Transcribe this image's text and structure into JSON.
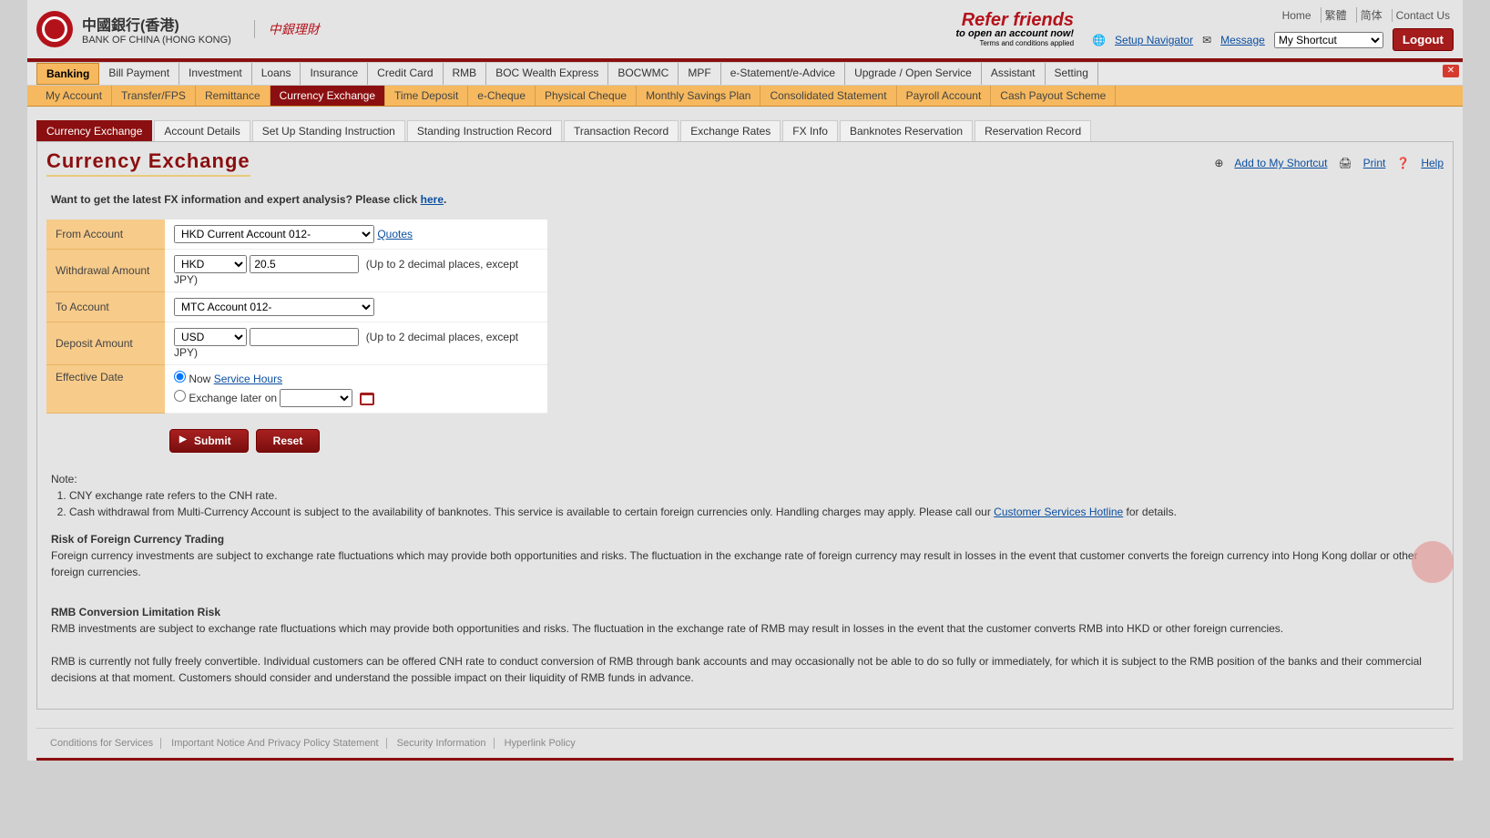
{
  "header": {
    "bank_name_cn": "中國銀行(香港)",
    "bank_name_en": "BANK OF CHINA (HONG KONG)",
    "wealth_brand": "中銀理財",
    "promo_title": "Refer friends",
    "promo_sub": "to open an account now!",
    "promo_terms": "Terms and conditions applied",
    "meta_links": [
      "Home",
      "繁體",
      "简体",
      "Contact Us"
    ],
    "setup_navigator": "Setup Navigator",
    "message": "Message",
    "shortcut_placeholder": "My Shortcut",
    "logout": "Logout"
  },
  "nav_main": [
    "Banking",
    "Bill Payment",
    "Investment",
    "Loans",
    "Insurance",
    "Credit Card",
    "RMB",
    "BOC Wealth Express",
    "BOCWMC",
    "MPF",
    "e-Statement/e-Advice",
    "Upgrade / Open Service",
    "Assistant",
    "Setting"
  ],
  "nav_main_active": 0,
  "nav_sub": [
    "My Account",
    "Transfer/FPS",
    "Remittance",
    "Currency Exchange",
    "Time Deposit",
    "e-Cheque",
    "Physical Cheque",
    "Monthly Savings Plan",
    "Consolidated Statement",
    "Payroll Account",
    "Cash Payout Scheme"
  ],
  "nav_sub_active": 3,
  "tabs": [
    "Currency Exchange",
    "Account Details",
    "Set Up Standing Instruction",
    "Standing Instruction Record",
    "Transaction Record",
    "Exchange Rates",
    "FX Info",
    "Banknotes Reservation",
    "Reservation Record"
  ],
  "tabs_active": 0,
  "page_title": "Currency Exchange",
  "page_actions": {
    "add_shortcut": "Add to My Shortcut",
    "print": "Print",
    "help": "Help"
  },
  "intro": {
    "prefix": "Want to get the latest FX information and expert analysis? Please click ",
    "link": "here",
    "suffix": "."
  },
  "form": {
    "labels": {
      "from": "From Account",
      "withdraw": "Withdrawal Amount",
      "to": "To Account",
      "deposit": "Deposit Amount",
      "date": "Effective Date"
    },
    "from_account": "HKD Current Account 012-",
    "quotes_link": "Quotes",
    "withdraw_ccy": "HKD",
    "withdraw_amt": "20.5",
    "amount_hint": "(Up to 2 decimal places, except JPY)",
    "to_account": "MTC Account 012-",
    "deposit_ccy": "USD",
    "deposit_amt": "",
    "now_label": "Now",
    "service_hours": "Service Hours",
    "later_label": "Exchange later on",
    "submit": "Submit",
    "reset": "Reset"
  },
  "notes": {
    "heading": "Note:",
    "items": [
      "CNY exchange rate refers to the CNH rate.",
      "Cash withdrawal from Multi-Currency Account is subject to the availability of banknotes. This service is available to certain foreign currencies only. Handling charges may apply. Please call our "
    ],
    "csh_link": "Customer Services Hotline",
    "csh_suffix": " for details.",
    "risk1_title": "Risk of Foreign Currency Trading",
    "risk1_body": "Foreign currency investments are subject to exchange rate fluctuations which may provide both opportunities and risks. The fluctuation in the exchange rate of foreign currency may result in losses in the event that customer converts the foreign currency into Hong Kong dollar or other foreign currencies.",
    "risk2_title": "RMB Conversion Limitation Risk",
    "risk2_body": "RMB investments are subject to exchange rate fluctuations which may provide both opportunities and risks. The fluctuation in the exchange rate of RMB may result in losses in the event that the customer converts RMB into HKD or other foreign currencies.",
    "risk2_body2": "RMB is currently not fully freely convertible. Individual customers can be offered CNH rate to conduct conversion of RMB through bank accounts and may occasionally not be able to do so fully or immediately, for which it is subject to the RMB position of the banks and their commercial decisions at that moment. Customers should consider and understand the possible impact on their liquidity of RMB funds in advance."
  },
  "footer_links": [
    "Conditions for Services",
    "Important Notice And Privacy Policy Statement",
    "Security Information",
    "Hyperlink Policy"
  ]
}
